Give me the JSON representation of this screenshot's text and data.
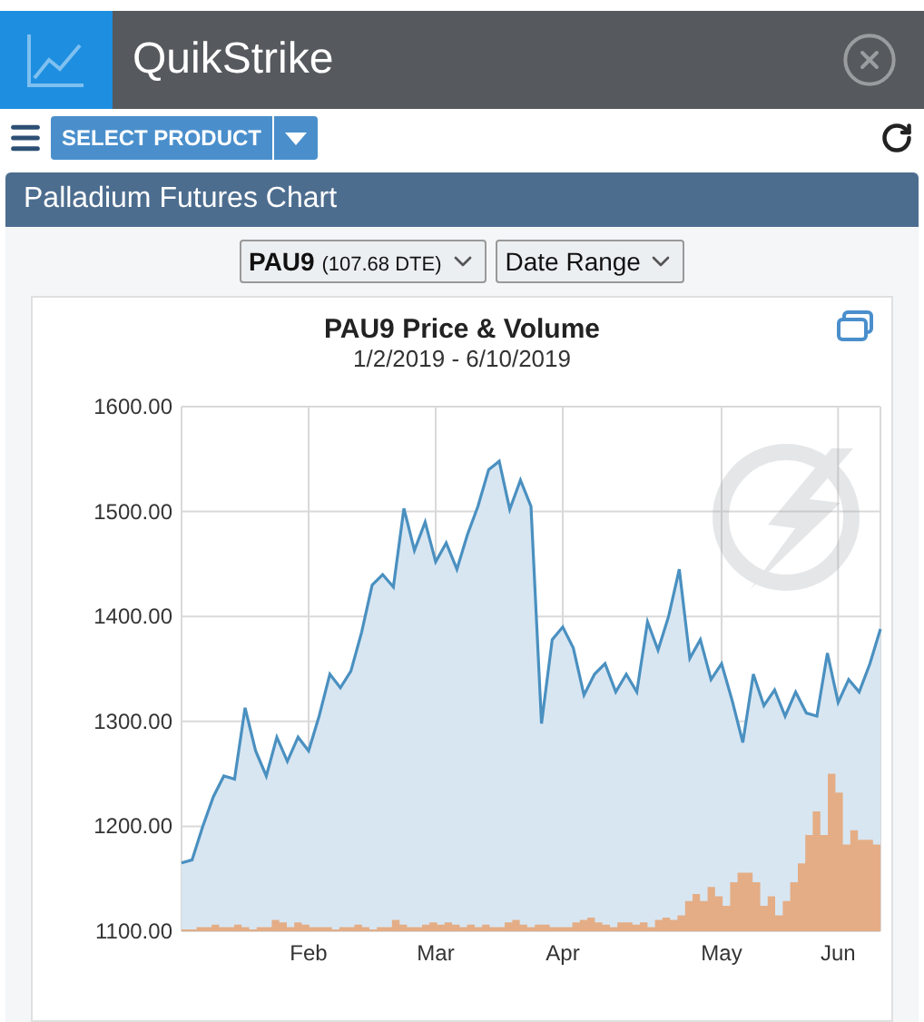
{
  "app_bar": {
    "title": "QuikStrike"
  },
  "toolbar": {
    "product_button": "SELECT PRODUCT"
  },
  "panel": {
    "title": "Palladium Futures Chart",
    "selectors": [
      {
        "kind": "contract",
        "label": "PAU9",
        "detail": "(107.68 DTE)"
      },
      {
        "kind": "range",
        "label": "Date Range"
      }
    ],
    "chart": {
      "title": "PAU9 Price & Volume",
      "subtitle": "1/2/2019 - 6/10/2019",
      "chart_data": {
        "type": "area",
        "grid": true,
        "ylim": [
          1100,
          1600
        ],
        "yticks": [
          {
            "value": 1100,
            "label": "1100.00"
          },
          {
            "value": 1200,
            "label": "1200.00"
          },
          {
            "value": 1300,
            "label": "1300.00"
          },
          {
            "value": 1400,
            "label": "1400.00"
          },
          {
            "value": 1500,
            "label": "1500.00"
          },
          {
            "value": 1600,
            "label": "1600.00"
          }
        ],
        "categories": [
          null,
          null,
          null,
          null,
          null,
          null,
          null,
          null,
          null,
          null,
          null,
          null,
          "Feb",
          null,
          null,
          null,
          null,
          null,
          null,
          null,
          null,
          null,
          null,
          null,
          "Mar",
          null,
          null,
          null,
          null,
          null,
          null,
          null,
          null,
          null,
          null,
          null,
          "Apr",
          null,
          null,
          null,
          null,
          null,
          null,
          null,
          null,
          null,
          null,
          null,
          null,
          null,
          null,
          "May",
          null,
          null,
          null,
          null,
          null,
          null,
          null,
          null,
          null,
          null,
          "Jun",
          null,
          null,
          null,
          null
        ],
        "series": [
          {
            "color": "#4a90c0",
            "values": [
              1165,
              1168,
              1200,
              1228,
              1248,
              1245,
              1313,
              1272,
              1248,
              1285,
              1262,
              1285,
              1272,
              1305,
              1345,
              1332,
              1348,
              1385,
              1430,
              1440,
              1428,
              1503,
              1463,
              1490,
              1452,
              1470,
              1445,
              1478,
              1505,
              1540,
              1548,
              1502,
              1530,
              1505,
              1298,
              1378,
              1390,
              1370,
              1325,
              1345,
              1355,
              1328,
              1345,
              1328,
              1395,
              1368,
              1400,
              1445,
              1360,
              1378,
              1340,
              1355,
              1320,
              1280,
              1345,
              1315,
              1330,
              1305,
              1328,
              1308,
              1305,
              1365,
              1318,
              1340,
              1328,
              1355,
              1388
            ]
          }
        ]
      }
    }
  }
}
